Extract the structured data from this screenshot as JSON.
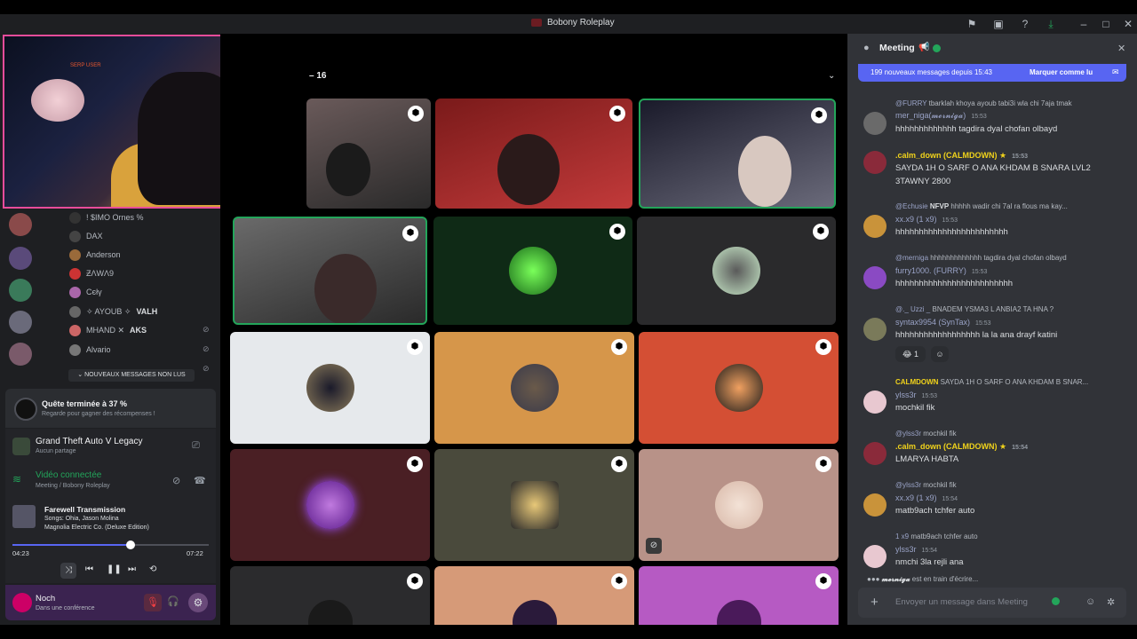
{
  "window": {
    "title": "Bobony Roleplay"
  },
  "stream": {
    "count": "16",
    "sign_text": "SERP USER"
  },
  "members": [
    {
      "name": "! $IMO Ornes %",
      "color": "#b5bac1"
    },
    {
      "name": "DAX",
      "color": "#b5bac1"
    },
    {
      "name": "Anderson",
      "color": "#b5bac1"
    },
    {
      "name": "ƵΛWΛ9",
      "color": "#b5bac1"
    },
    {
      "name": "Cєłγ",
      "color": "#b5bac1"
    },
    {
      "name": "✧ AYOUB ✧",
      "tag": "VALH",
      "color": "#b5bac1"
    },
    {
      "name": "MHAND ✕",
      "tag": "AKS",
      "color": "#b5bac1"
    },
    {
      "name": "Alvario",
      "color": "#b5bac1"
    }
  ],
  "new_messages_pill": "NOUVEAUX MESSAGES NON LUS",
  "quest": {
    "title": "Quête terminée à 37 %",
    "subtitle": "Regarde pour gagner des récompenses !"
  },
  "game": {
    "title": "Grand Theft Auto V Legacy",
    "subtitle": "Aucun partage"
  },
  "voice": {
    "status": "Vidéo connectée",
    "channel": "Meeting",
    "server": "/ Bobony Roleplay"
  },
  "music": {
    "title": "Farewell Transmission",
    "artist": "Songs: Ohia, Jason Molina",
    "album": "Magnolia Electric Co. (Deluxe Edition)",
    "elapsed": "04:23",
    "total": "07:22",
    "progress": 0.6
  },
  "user": {
    "name": "Noch",
    "status": "Dans une conférence"
  },
  "chat": {
    "channel": "Meeting",
    "banner_left": "199 nouveaux messages depuis 15:43",
    "banner_right": "Marquer comme lu",
    "placeholder": "Envoyer un message dans Meeting",
    "typing": "est en train d'écrire...",
    "typing_user": "𝓶𝓮𝓻𝓷𝓲𝓰𝓪",
    "messages": [
      {
        "reply_user": "@FURRY",
        "reply_text": "tbarklah khoya ayoub tabi3i wla chi 7aja tmak",
        "name": "mer_niga(𝓶𝓮𝓻𝓷𝓲𝓰𝓪)",
        "name_color": "#9aa3c7",
        "time": "15:53",
        "text": "hhhhhhhhhhhhh tagdira dyal chofan olbayd"
      },
      {
        "reply_user": "",
        "reply_text": "",
        "name": ".calm_down (CALMDOWN)",
        "name_color": "#f0d21b",
        "time": "15:53",
        "text": "SAYDA 1H O SARF O ANA KHDAM B SNARA LVL2",
        "text2": "3TAWNY 2800"
      },
      {
        "reply_user": "@Echusie",
        "reply_text": "hhhhh wadir chi 7al ra flous ma kay...",
        "reply_tag": "NFVP",
        "name": "xx.x9 (1 x9)",
        "name_color": "#9aa3c7",
        "time": "15:53",
        "text": "hhhhhhhhhhhhhhhhhhhhhhhh"
      },
      {
        "reply_user": "@merniga",
        "reply_text": "hhhhhhhhhhhhh tagdira dyal chofan olbayd",
        "name": "furry1000. (FURRY)",
        "name_color": "#9aa3c7",
        "time": "15:53",
        "text": "hhhhhhhhhhhhhhhhhhhhhhhhh"
      },
      {
        "reply_user": "@._ Uzzi _",
        "reply_text": "BNADEM YSMA3 L ANBIA2 TA HNA ?",
        "name": "syntax9954 (SynTax)",
        "name_color": "#9aa3c7",
        "time": "15:53",
        "text": "hhhhhhhhhhhhhhhhhh la la ana drayf katini",
        "reaction": "1"
      },
      {
        "reply_user": "CALMDOWN",
        "reply_text": "SAYDA 1H O SARF O ANA KHDAM B SNAR...",
        "name": "ylss3r",
        "name_color": "#9aa3c7",
        "time": "15:53",
        "text": "mochkil fik"
      },
      {
        "reply_user": "@ylss3r",
        "reply_text": "mochkil fik",
        "name": ".calm_down (CALMDOWN)",
        "name_color": "#f0d21b",
        "time": "15:54",
        "text": "LMARYA HABTA"
      },
      {
        "reply_user": "@ylss3r",
        "reply_text": "mochkil fik",
        "name": "xx.x9 (1 x9)",
        "name_color": "#9aa3c7",
        "time": "15:54",
        "text": "matb9ach tchfer auto"
      },
      {
        "reply_user": "1 x9",
        "reply_text": "matb9ach tchfer auto",
        "name": "ylss3r",
        "name_color": "#9aa3c7",
        "time": "15:54",
        "text": "nmchi 3la rejli ana"
      }
    ]
  },
  "colors": {
    "accent": "#5865f2",
    "pink": "#e84c9a",
    "green": "#23a55a"
  }
}
